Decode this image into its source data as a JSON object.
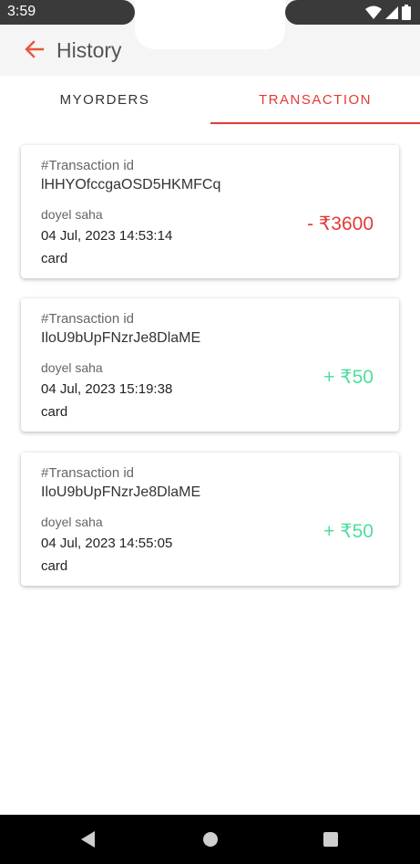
{
  "status_bar": {
    "time": "3:59",
    "icons": [
      "wifi-icon",
      "signal-icon",
      "battery-icon"
    ]
  },
  "app_bar": {
    "title": "History",
    "back_icon": "arrow-left-icon"
  },
  "tabs": [
    {
      "label": "MYORDERS",
      "active": false
    },
    {
      "label": "TRANSACTION",
      "active": true
    }
  ],
  "transactions": [
    {
      "id_label": "#Transaction id",
      "id": "lHHYOfccgaOSD5HKMFCq",
      "name": "doyel saha",
      "datetime": "04 Jul, 2023 14:53:14",
      "method": "card",
      "amount": "- ₹3600",
      "type": "debit"
    },
    {
      "id_label": "#Transaction id",
      "id": "IloU9bUpFNzrJe8DlaME",
      "name": "doyel saha",
      "datetime": "04 Jul, 2023 15:19:38",
      "method": "card",
      "amount": "+ ₹50",
      "type": "credit"
    },
    {
      "id_label": "#Transaction id",
      "id": "IloU9bUpFNzrJe8DlaME",
      "name": "doyel saha",
      "datetime": "04 Jul, 2023 14:55:05",
      "method": "card",
      "amount": "+ ₹50",
      "type": "credit"
    }
  ],
  "colors": {
    "accent": "#e53935",
    "debit": "#e53935",
    "credit": "#4ddf9e",
    "app_bar_bg": "#f5f5f5"
  },
  "nav_bar": {
    "buttons": [
      "back-triangle-icon",
      "home-circle-icon",
      "recents-square-icon"
    ]
  }
}
